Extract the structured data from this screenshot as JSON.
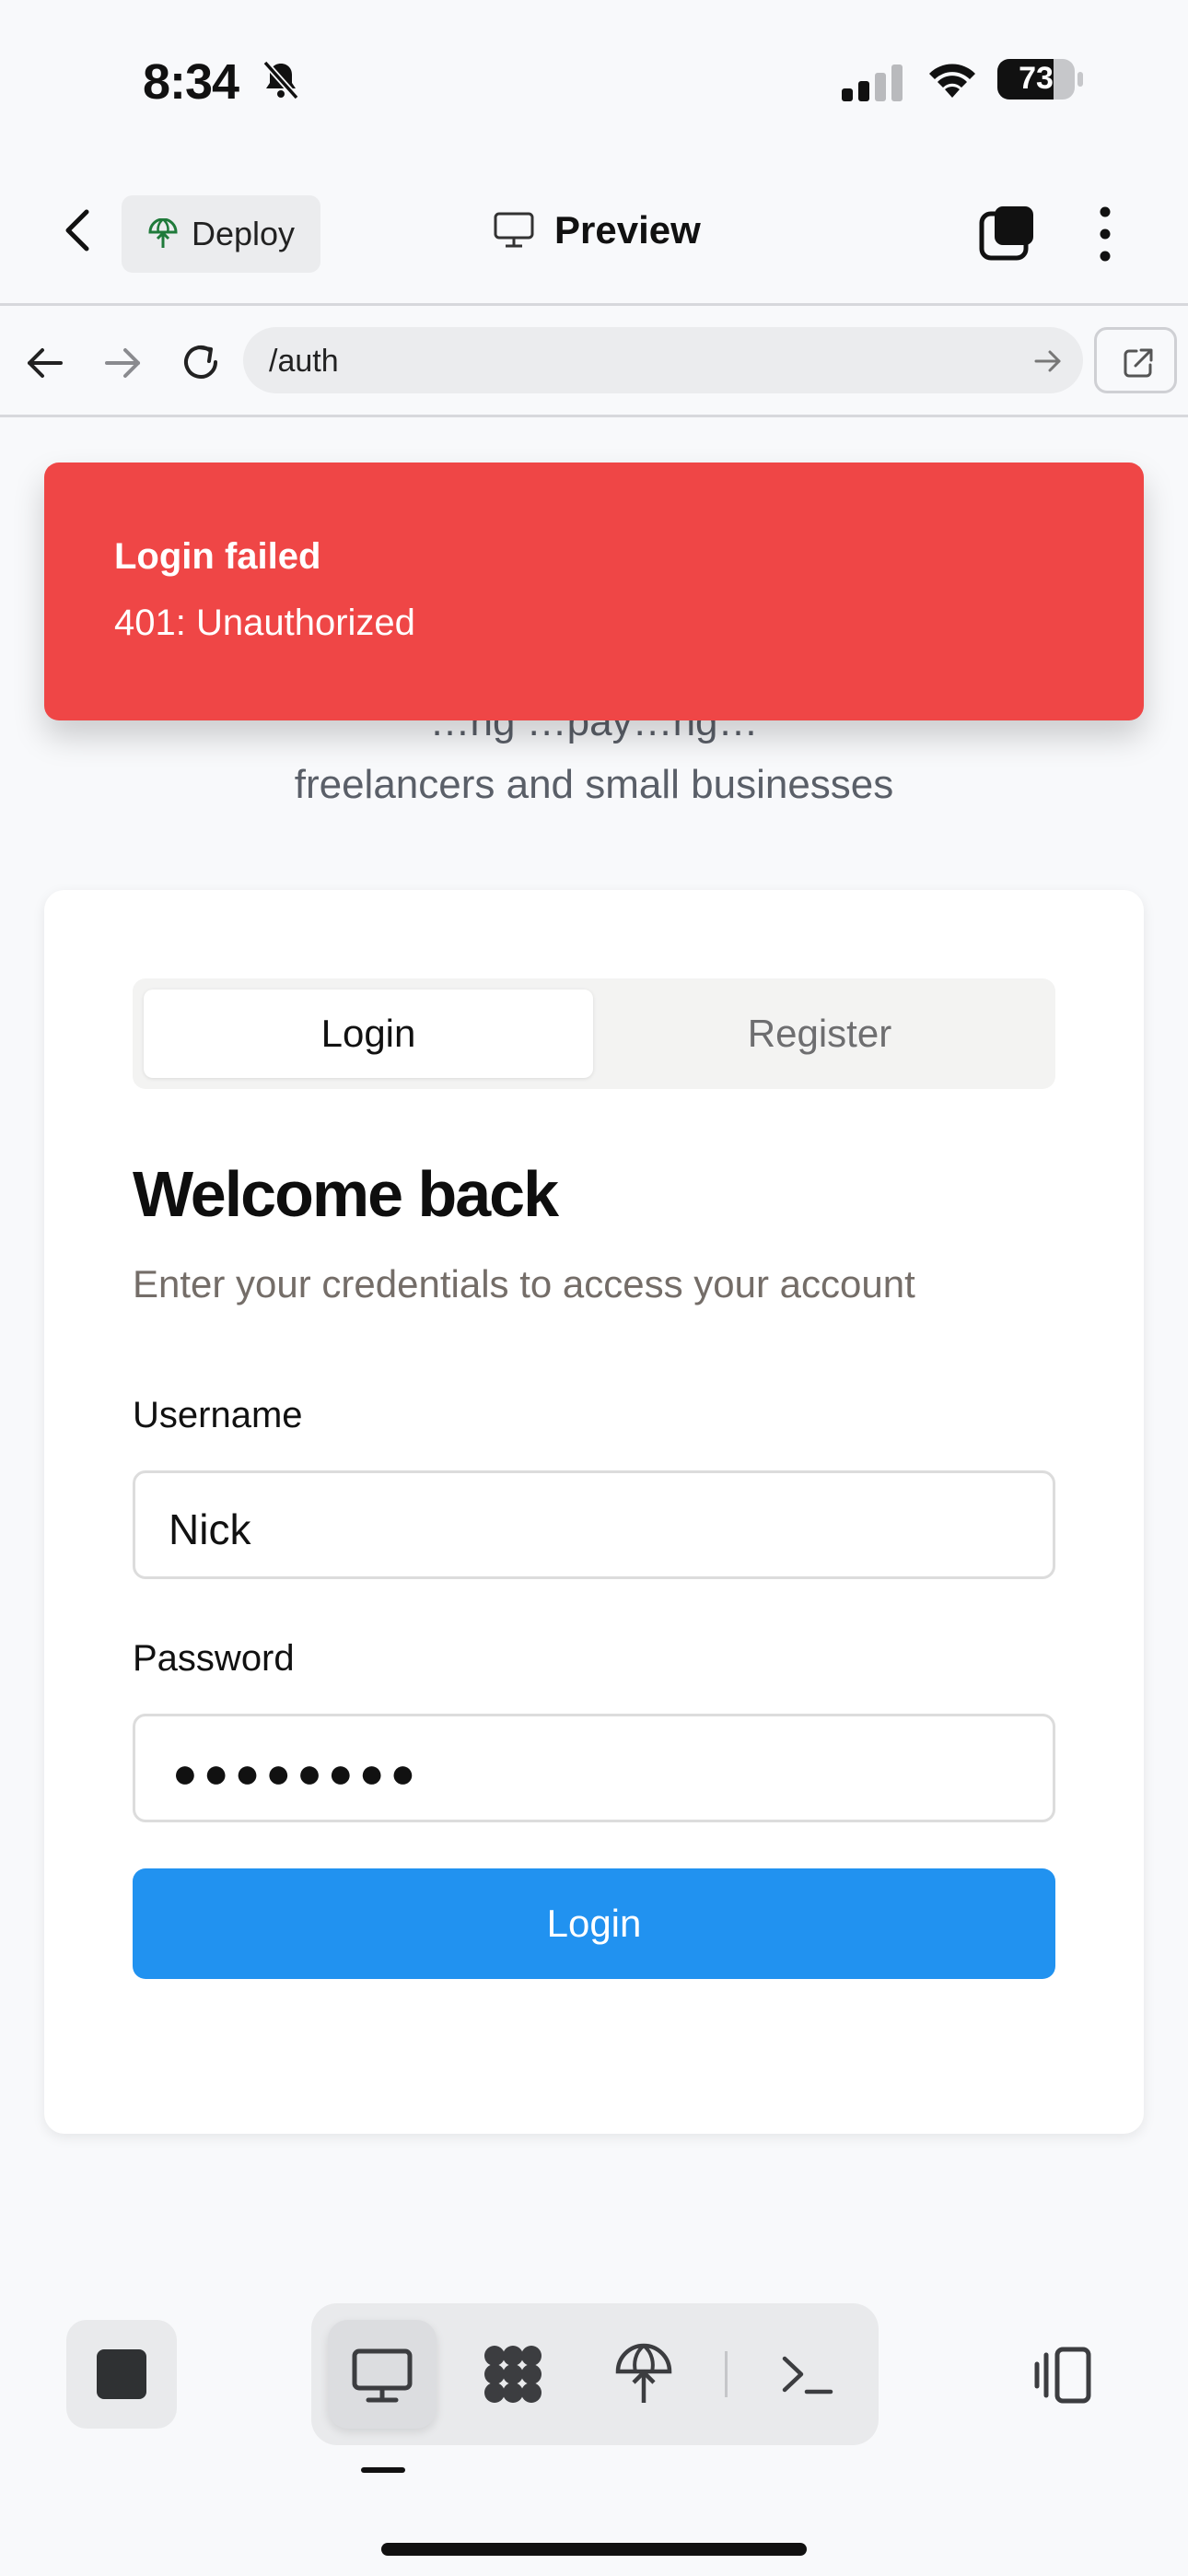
{
  "status_bar": {
    "time": "8:34",
    "battery": "73"
  },
  "header": {
    "deploy_label": "Deploy",
    "title": "Preview"
  },
  "browser": {
    "url": "/auth"
  },
  "toast": {
    "title": "Login failed",
    "description": "401: Unauthorized"
  },
  "hero": {
    "subtitle_partial": "…ng …pay…ng…",
    "subtitle_line2": "freelancers and small businesses"
  },
  "auth_card": {
    "tabs": [
      {
        "label": "Login",
        "active": true
      },
      {
        "label": "Register",
        "active": false
      }
    ],
    "heading": "Welcome back",
    "description": "Enter your credentials to access your account",
    "username": {
      "label": "Username",
      "value": "Nick"
    },
    "password": {
      "label": "Password",
      "masked_value": "●●●●●●●●"
    },
    "submit_label": "Login"
  },
  "colors": {
    "toast_bg": "#ef4646",
    "primary_button": "#2192f0",
    "page_bg": "#f8f9fb"
  },
  "toolbar": {
    "tools": [
      "desktop-icon",
      "apps-icon",
      "deploy-icon",
      "terminal-icon"
    ],
    "active_tool": "desktop-icon"
  }
}
